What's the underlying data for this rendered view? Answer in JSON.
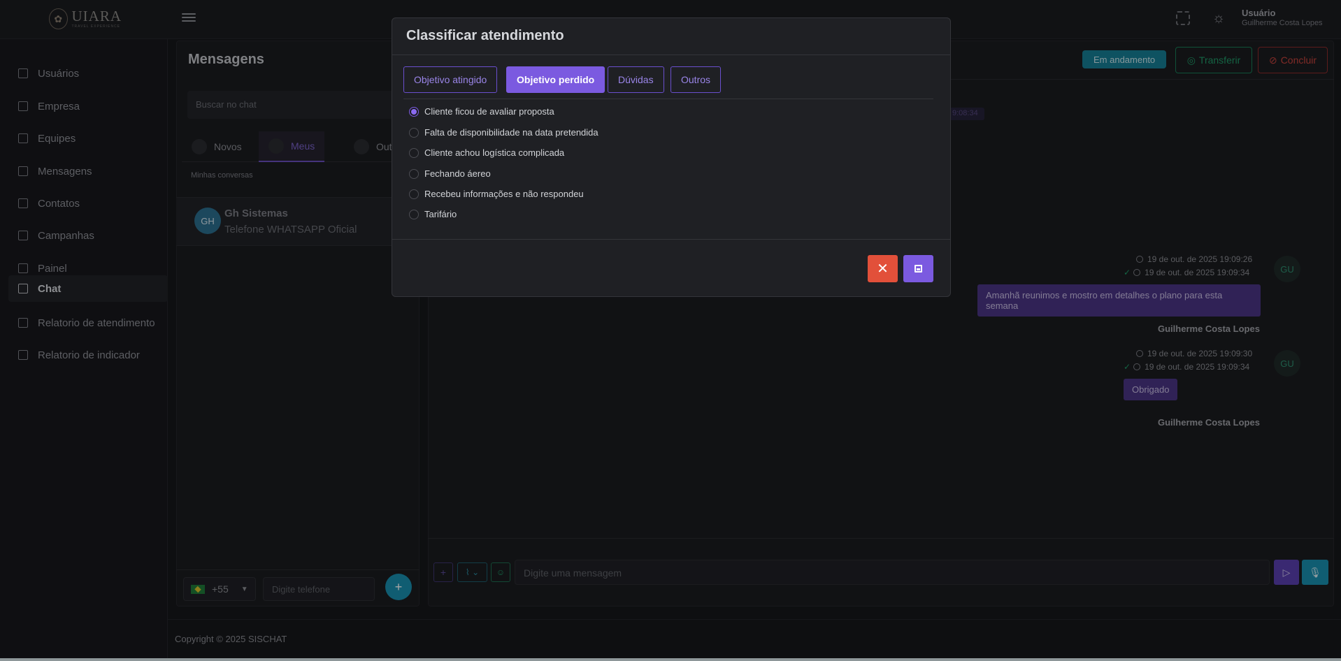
{
  "header": {
    "brand": "UIARA",
    "brand_tagline": "TRAVEL EXPERIENCE",
    "user_label": "Usuário",
    "user_name": "Guilherme Costa Lopes"
  },
  "sidebar": {
    "items": [
      {
        "label": "Usuários",
        "icon": "home-icon"
      },
      {
        "label": "Empresa",
        "icon": "building-icon"
      },
      {
        "label": "Equipes",
        "icon": "fingerprint-icon"
      },
      {
        "label": "Mensagens",
        "icon": "file-icon"
      },
      {
        "label": "Contatos",
        "icon": "contact-icon"
      },
      {
        "label": "Campanhas",
        "icon": "gift-icon"
      },
      {
        "label": "Painel",
        "icon": "document-icon"
      },
      {
        "label": "Chat",
        "icon": "grid-icon",
        "active": true
      },
      {
        "label": "Relatorio de atendimento",
        "icon": "table-icon"
      },
      {
        "label": "Relatorio de indicador",
        "icon": "bar-chart-icon"
      }
    ]
  },
  "messages_panel": {
    "title": "Mensagens",
    "search_placeholder": "Buscar no chat",
    "tabs": [
      {
        "label": "Novos"
      },
      {
        "label": "Meus",
        "active": true
      },
      {
        "label": "Out"
      }
    ],
    "section_label": "Minhas conversas",
    "conversation": {
      "initials": "GH",
      "name": "Gh Sistemas",
      "subtitle": "Telefone WHATSAPP Oficial"
    },
    "ddi": "+55",
    "phone_placeholder": "Digite telefone"
  },
  "chat": {
    "status_badge": "Em andamento",
    "transfer_label": "Transferir",
    "conclude_label": "Concluir",
    "faded_time": "9:08:34",
    "messages": [
      {
        "sent": "19 de out. de 2025 19:09:26",
        "read": "19 de out. de 2025 19:09:34",
        "text": "Amanhã reunimos e mostro em detalhes o plano para esta semana",
        "sender": "Guilherme Costa Lopes",
        "initials": "GU"
      },
      {
        "sent": "19 de out. de 2025 19:09:30",
        "read": "19 de out. de 2025 19:09:34",
        "text": "Obrigado",
        "sender": "Guilherme Costa Lopes",
        "initials": "GU"
      }
    ],
    "message_placeholder": "Digite uma mensagem"
  },
  "footer": {
    "copyright": "Copyright © 2025 SISCHAT"
  },
  "modal": {
    "title": "Classificar atendimento",
    "tabs": [
      {
        "label": "Objetivo atingido"
      },
      {
        "label": "Objetivo perdido",
        "active": true
      },
      {
        "label": "Dúvidas"
      },
      {
        "label": "Outros"
      }
    ],
    "options": [
      {
        "label": "Cliente ficou de avaliar proposta",
        "checked": true
      },
      {
        "label": "Falta de disponibilidade na data pretendida"
      },
      {
        "label": "Cliente achou logística complicada"
      },
      {
        "label": "Fechando áereo"
      },
      {
        "label": "Recebeu informações e não respondeu"
      },
      {
        "label": "Tarifário"
      }
    ]
  },
  "colors": {
    "accent": "#7b5ae0",
    "danger": "#e2503a",
    "info": "#1a8fb0",
    "success": "#1f9a68"
  }
}
